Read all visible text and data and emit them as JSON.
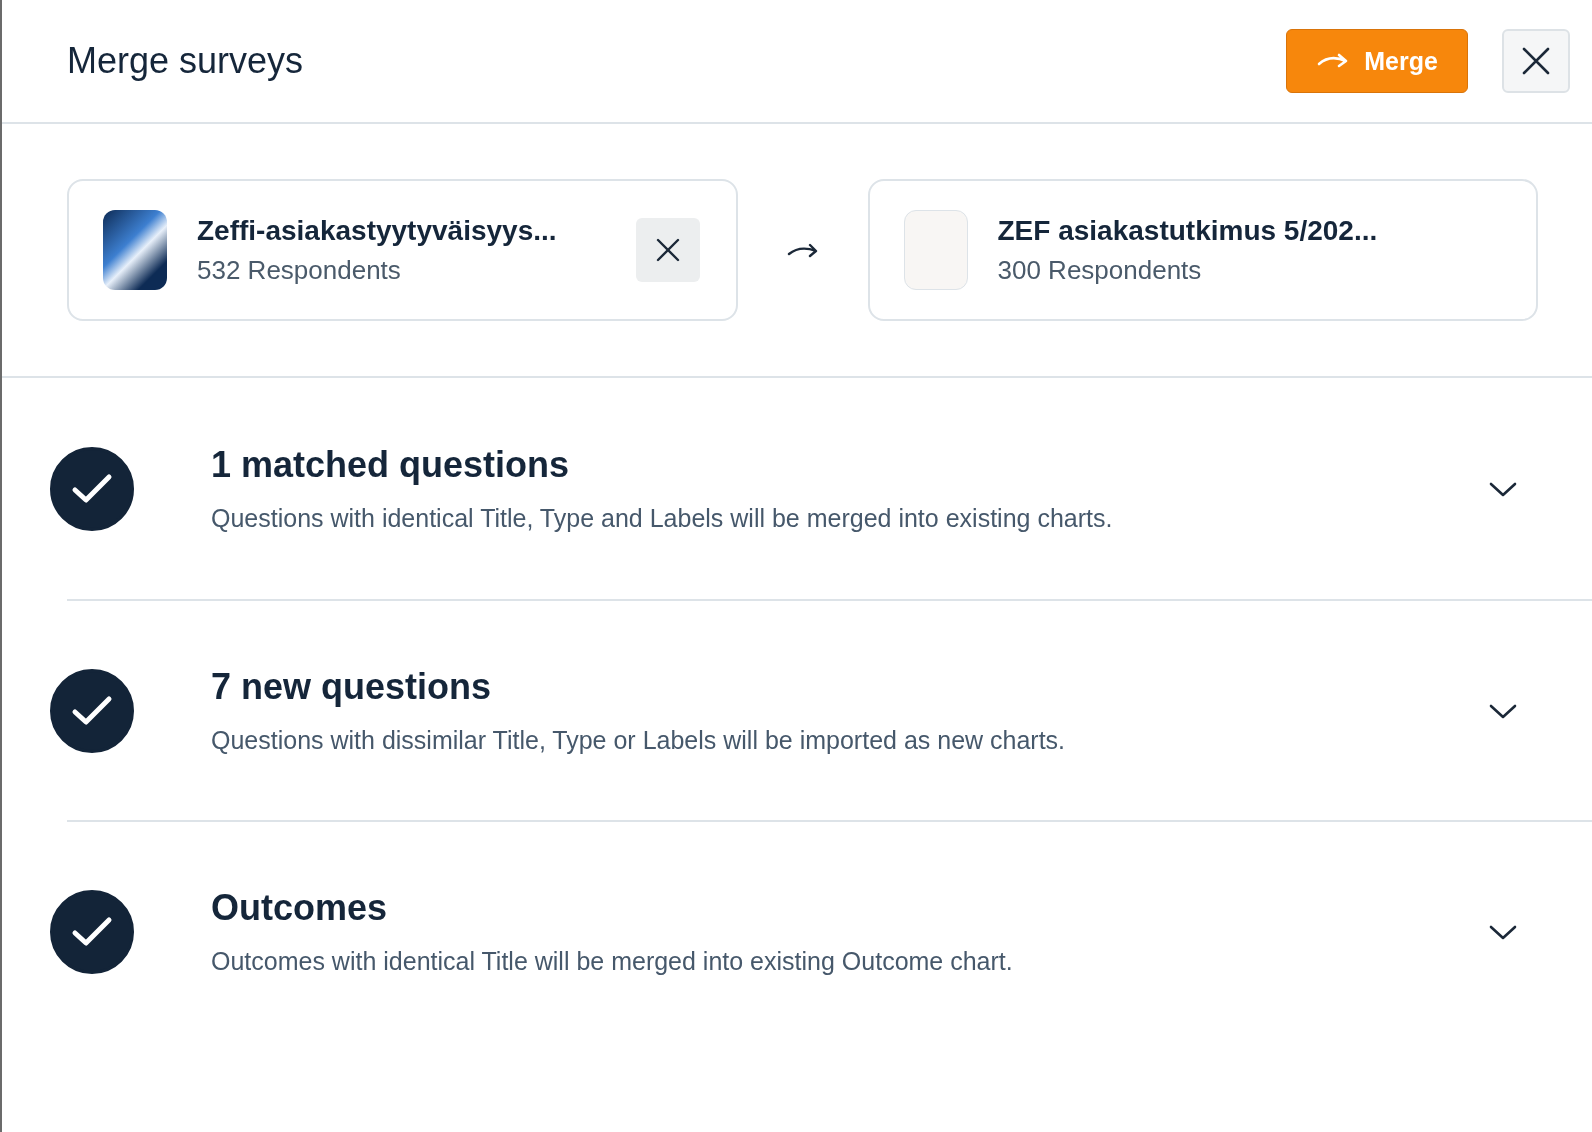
{
  "header": {
    "title": "Merge surveys",
    "merge_button": "Merge"
  },
  "source_survey": {
    "name": "Zeffi-asiakastyytyväisyys...",
    "respondents": "532 Respondents",
    "removable": true
  },
  "target_survey": {
    "name": "ZEF asiakastutkimus 5/202...",
    "respondents": "300 Respondents",
    "removable": false
  },
  "sections": [
    {
      "title": "1 matched questions",
      "description": "Questions with identical Title, Type and Labels will be merged into existing charts.",
      "checked": true,
      "expanded": false
    },
    {
      "title": "7 new questions",
      "description": "Questions with dissimilar Title, Type or Labels will be imported as new charts.",
      "checked": true,
      "expanded": false
    },
    {
      "title": "Outcomes",
      "description": "Outcomes with identical Title will be merged into existing Outcome chart.",
      "checked": true,
      "expanded": false
    }
  ]
}
